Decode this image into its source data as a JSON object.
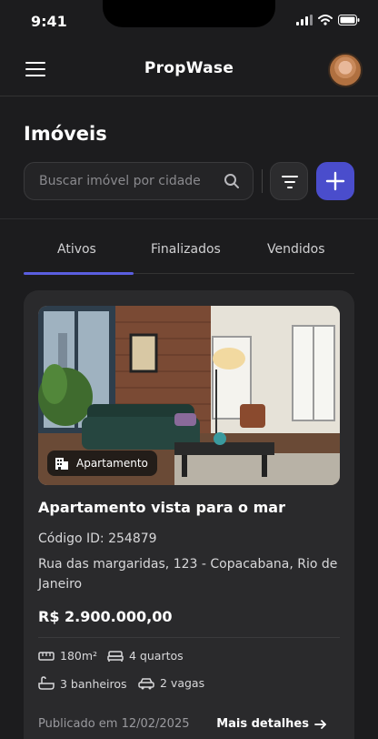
{
  "status_bar": {
    "time": "9:41"
  },
  "app": {
    "brand": "PropWase"
  },
  "page": {
    "title": "Imóveis",
    "search": {
      "placeholder": "Buscar imóvel por cidade"
    }
  },
  "tabs": [
    {
      "label": "Ativos",
      "active": true
    },
    {
      "label": "Finalizados",
      "active": false
    },
    {
      "label": "Vendidos",
      "active": false
    }
  ],
  "listing": {
    "type": "Apartamento",
    "title": "Apartamento vista para o mar",
    "code": "Código ID: 254879",
    "address": "Rua das margaridas, 123 - Copacabana, Rio de Janeiro",
    "price": "R$ 2.900.000,00",
    "features": {
      "area": "180m²",
      "rooms": "4 quartos",
      "bathrooms": "3 banheiros",
      "parking": "2 vagas"
    },
    "published": "Publicado em 12/02/2025",
    "details_link": "Mais detalhes"
  },
  "colors": {
    "background": "#1c1c1e",
    "card": "#2a2a2c",
    "accent": "#4a4dcc",
    "tab_indicator": "#5a5ee0"
  },
  "icons": {
    "menu": "hamburger-menu-icon",
    "search": "search-icon",
    "filter": "filter-icon",
    "add": "plus-icon",
    "type": "building-icon",
    "area": "ruler-icon",
    "rooms": "bed-icon",
    "bathrooms": "bathtub-icon",
    "parking": "car-icon",
    "details": "arrow-right-icon"
  }
}
